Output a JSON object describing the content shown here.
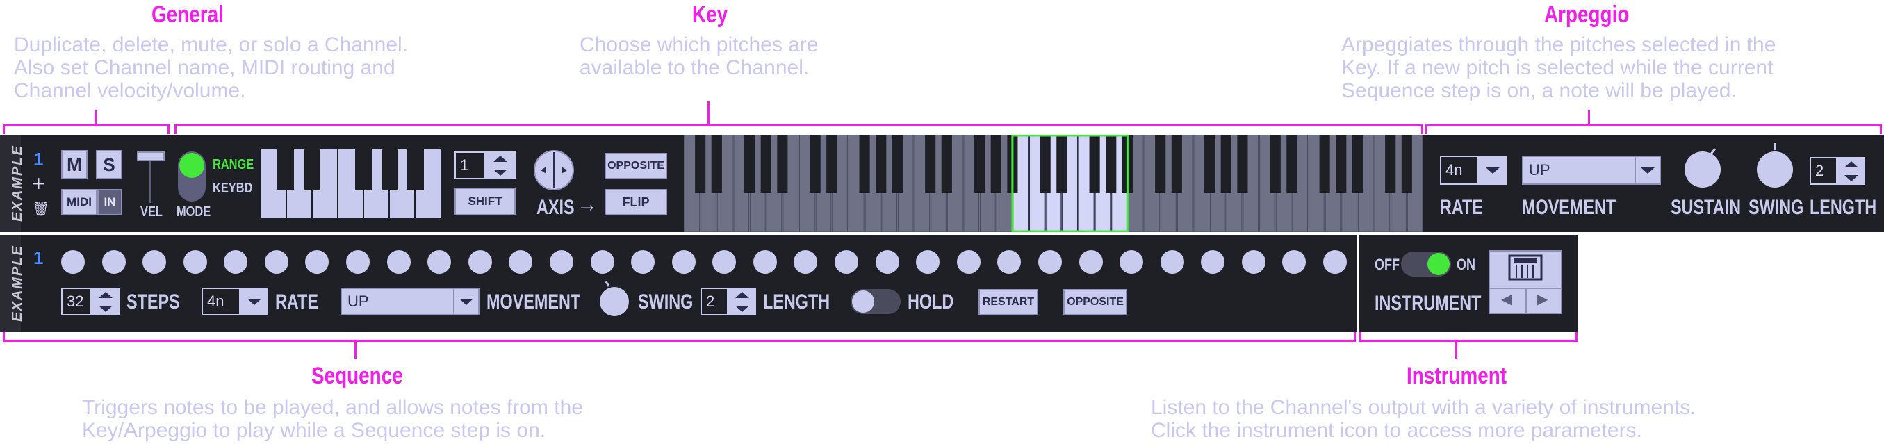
{
  "sections": {
    "general": {
      "title": "General",
      "desc": [
        "Duplicate, delete, mute, or solo a Channel.",
        "Also set Channel name, MIDI routing and",
        "Channel velocity/volume."
      ]
    },
    "key": {
      "title": "Key",
      "desc": [
        "Choose which pitches are",
        "available to the Channel."
      ]
    },
    "arpeggio": {
      "title": "Arpeggio",
      "desc": [
        "Arpeggiates through the pitches selected in the",
        "Key. If a new pitch is selected while the current",
        "Sequence step is on, a note will be played."
      ]
    },
    "sequence": {
      "title": "Sequence",
      "desc": [
        "Triggers notes to be played, and allows notes from the",
        "Key/Arpeggio to play while a Sequence step is on."
      ]
    },
    "instrument": {
      "title": "Instrument",
      "desc": [
        "Listen to the Channel's output with a variety of instruments.",
        "Click the instrument icon to access more parameters."
      ]
    }
  },
  "channel": {
    "name_label": "EXAMPLE",
    "number": "1",
    "mute_label": "M",
    "solo_label": "S",
    "midi_label": "MIDI",
    "in_label": "IN",
    "vel_label": "VEL",
    "mode_label": "MODE",
    "range_label": "RANGE",
    "keybd_label": "KEYBD",
    "add_symbol": "+",
    "delete_symbol": "🗑"
  },
  "key": {
    "shift_value": "1",
    "shift_label": "SHIFT",
    "axis_label": "AXIS",
    "axis_arrow": "→",
    "opposite_label": "OPPOSITE",
    "flip_label": "FLIP"
  },
  "arpeggio": {
    "rate_value": "4n",
    "rate_label": "RATE",
    "movement_value": "UP",
    "movement_label": "MOVEMENT",
    "sustain_label": "SUSTAIN",
    "swing_label": "SWING",
    "length_value": "2",
    "length_label": "LENGTH"
  },
  "sequence": {
    "channel_label": "EXAMPLE",
    "number": "1",
    "step_count": 32,
    "steps_value": "32",
    "steps_label": "STEPS",
    "rate_value": "4n",
    "rate_label": "RATE",
    "movement_value": "UP",
    "movement_label": "MOVEMENT",
    "swing_label": "SWING",
    "length_value": "2",
    "length_label": "LENGTH",
    "hold_label": "HOLD",
    "restart_label": "RESTART",
    "opposite_label": "OPPOSITE"
  },
  "instrument": {
    "off_label": "OFF",
    "on_label": "ON",
    "instrument_label": "INSTRUMENT",
    "prev_symbol": "◀",
    "next_symbol": "▶"
  },
  "colors": {
    "accent": "#f01ee6",
    "active_green": "#44e83a",
    "panel": "#1f2026",
    "control": "#c8caee"
  }
}
